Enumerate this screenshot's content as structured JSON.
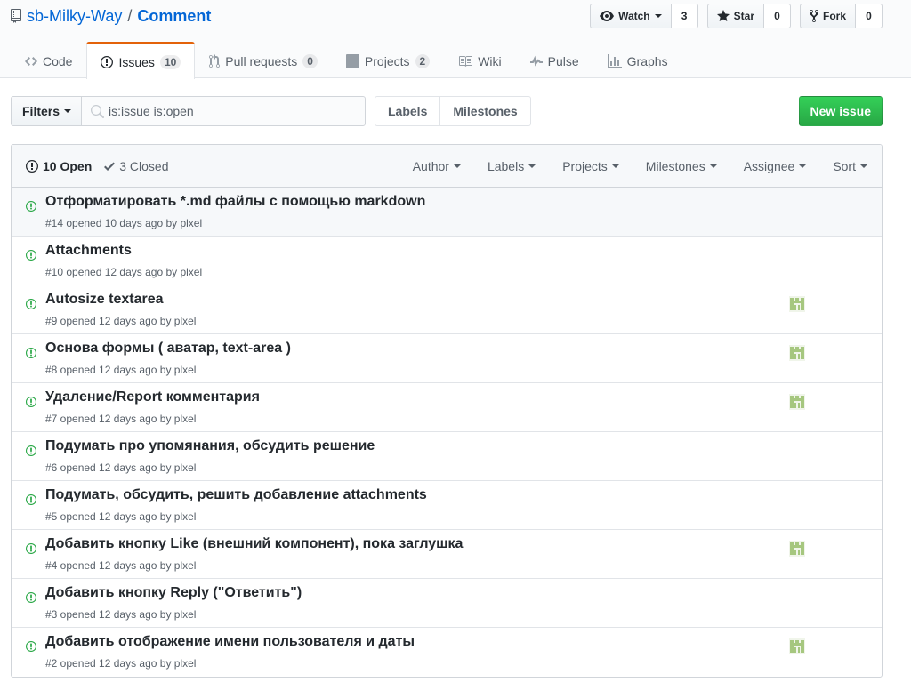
{
  "repo": {
    "owner": "sb-Milky-Way",
    "separator": "/",
    "name": "Comment"
  },
  "actions": {
    "watch": {
      "label": "Watch",
      "count": "3"
    },
    "star": {
      "label": "Star",
      "count": "0"
    },
    "fork": {
      "label": "Fork",
      "count": "0"
    }
  },
  "tabs": [
    {
      "label": "Code",
      "icon": "code-icon"
    },
    {
      "label": "Issues",
      "counter": "10",
      "icon": "issue-opened-icon",
      "selected": true
    },
    {
      "label": "Pull requests",
      "counter": "0",
      "icon": "pull-request-icon"
    },
    {
      "label": "Projects",
      "counter": "2",
      "icon": "project-icon"
    },
    {
      "label": "Wiki",
      "icon": "book-icon"
    },
    {
      "label": "Pulse",
      "icon": "pulse-icon"
    },
    {
      "label": "Graphs",
      "icon": "graph-icon"
    }
  ],
  "subnav": {
    "filters_label": "Filters",
    "search_value": "is:issue is:open",
    "labels_link": "Labels",
    "milestones_link": "Milestones",
    "new_issue_label": "New issue"
  },
  "table_header": {
    "open_label": "10 Open",
    "closed_label": "3 Closed",
    "filters": [
      "Author",
      "Labels",
      "Projects",
      "Milestones",
      "Assignee",
      "Sort"
    ]
  },
  "issues": [
    {
      "title": "Отформатировать *.md файлы с помощью markdown",
      "meta": "#14 opened 10 days ago by plxel",
      "assignee": false,
      "highlight": true
    },
    {
      "title": "Attachments",
      "meta": "#10 opened 12 days ago by plxel",
      "assignee": false
    },
    {
      "title": "Autosize textarea",
      "meta": "#9 opened 12 days ago by plxel",
      "assignee": true
    },
    {
      "title": "Основа формы ( аватар, text-area )",
      "meta": "#8 opened 12 days ago by plxel",
      "assignee": true
    },
    {
      "title": "Удаление/Report комментария",
      "meta": "#7 opened 12 days ago by plxel",
      "assignee": true
    },
    {
      "title": "Подумать про упомянания, обсудить решение",
      "meta": "#6 opened 12 days ago by plxel",
      "assignee": false
    },
    {
      "title": "Подумать, обсудить, решить добавление attachments",
      "meta": "#5 opened 12 days ago by plxel",
      "assignee": false
    },
    {
      "title": "Добавить кнопку Like (внешний компонент), пока заглушка",
      "meta": "#4 opened 12 days ago by plxel",
      "assignee": true
    },
    {
      "title": "Добавить кнопку Reply (\"Ответить\")",
      "meta": "#3 opened 12 days ago by plxel",
      "assignee": false
    },
    {
      "title": "Добавить отображение имени пользователя и даты",
      "meta": "#2 opened 12 days ago by plxel",
      "assignee": true
    }
  ],
  "colors": {
    "link": "#0366d6",
    "open_icon": "#28a745",
    "tab_accent": "#e36209",
    "new_issue_bg": "#28a745",
    "avatar": "#a6c77f"
  }
}
